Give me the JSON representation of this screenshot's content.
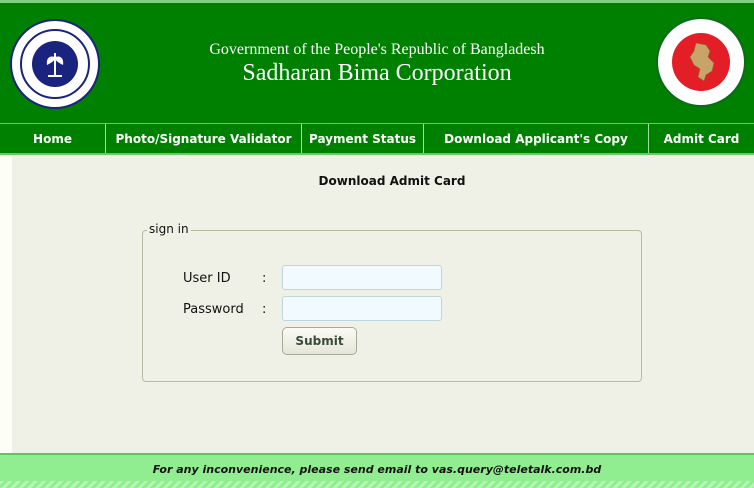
{
  "header": {
    "line1": "Government of the People's Republic of Bangladesh",
    "line2": "Sadharan Bima Corporation"
  },
  "nav": {
    "items": [
      {
        "label": "Home"
      },
      {
        "label": "Photo/Signature Validator"
      },
      {
        "label": "Payment Status"
      },
      {
        "label": "Download Applicant's Copy"
      },
      {
        "label": "Admit Card"
      }
    ]
  },
  "main": {
    "title": "Download Admit Card",
    "form": {
      "legend": "sign in",
      "user_id_label": "User ID",
      "password_label": "Password",
      "colon": ":",
      "user_id_value": "",
      "password_value": "",
      "submit_label": "Submit"
    }
  },
  "footer": {
    "text": "For any inconvenience, please send email to vas.query@teletalk.com.bd"
  },
  "colors": {
    "header_green": "#008000",
    "footer_green": "#90ee90",
    "content_bg": "#f0f1e6",
    "input_bg": "#f1fbff"
  },
  "icons": {
    "left_logo": "sadharan-bima-logo",
    "right_logo": "bangladesh-govt-seal"
  }
}
